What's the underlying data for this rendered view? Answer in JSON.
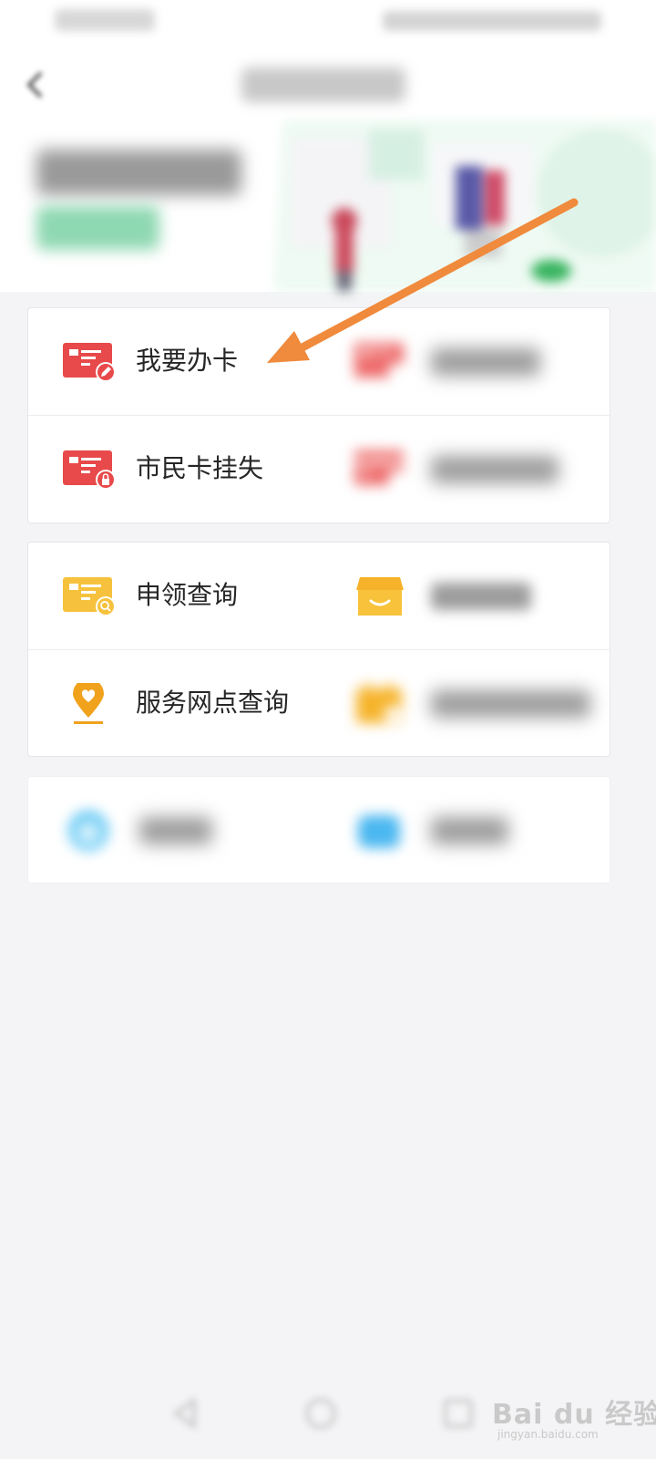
{
  "menu": {
    "group1": {
      "row1_left": {
        "label": "我要办卡",
        "icon": "card-edit-icon"
      },
      "row1_right": {
        "icon": "card-plus-icon"
      },
      "row2_left": {
        "label": "市民卡挂失",
        "icon": "card-lock-icon"
      },
      "row2_right": {
        "icon": "card-search-icon"
      }
    },
    "group2": {
      "row1_left": {
        "label": "申领查询",
        "icon": "card-search-icon"
      },
      "row1_right": {
        "icon": "store-icon"
      },
      "row2_left": {
        "label": "服务网点查询",
        "icon": "location-pin-icon"
      },
      "row2_right": {
        "icon": "calendar-icon"
      }
    },
    "group3": {
      "row1_left": {
        "icon": "customer-service-icon"
      },
      "row1_right": {
        "icon": "mail-icon"
      }
    }
  },
  "watermark": {
    "brand": "Bai du 经验",
    "url": "jingyan.baidu.com"
  },
  "colors": {
    "card_red": "#e8494a",
    "card_yellow": "#f6c23d",
    "pin_orange": "#f0a21c",
    "arrow": "#f08a3c",
    "accent_green": "#4cc488",
    "accent_blue": "#4ab7f0"
  }
}
